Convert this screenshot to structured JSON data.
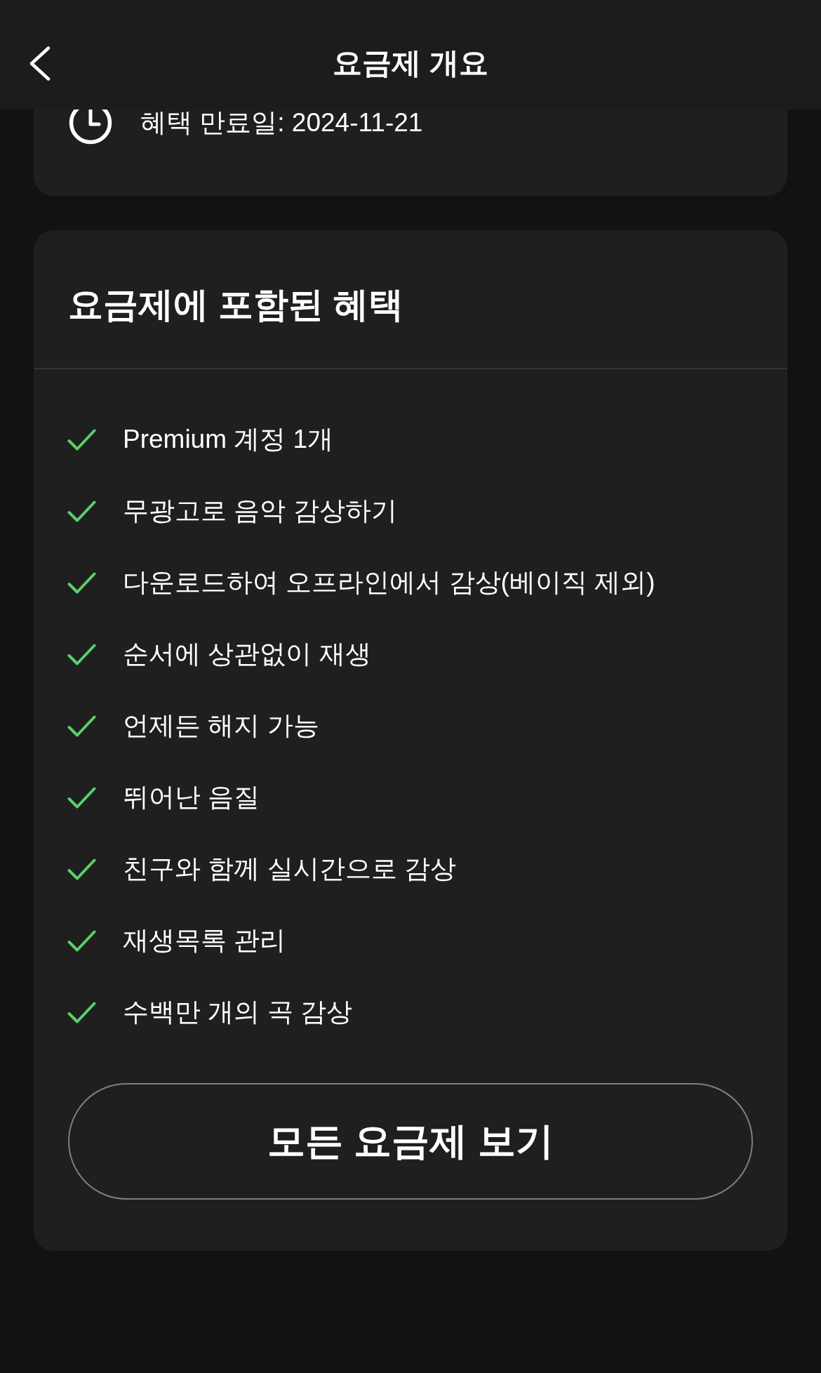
{
  "header": {
    "title": "요금제 개요"
  },
  "expiry": {
    "text": "혜택 만료일: 2024-11-21"
  },
  "benefits": {
    "title": "요금제에 포함된 혜택",
    "items": [
      "Premium 계정 1개",
      "무광고로 음악 감상하기",
      "다운로드하여 오프라인에서 감상(베이직 제외)",
      "순서에 상관없이 재생",
      "언제든 해지 가능",
      "뛰어난 음질",
      "친구와 함께 실시간으로 감상",
      "재생목록 관리",
      "수백만 개의 곡 감상"
    ]
  },
  "button": {
    "label": "모든 요금제 보기"
  }
}
